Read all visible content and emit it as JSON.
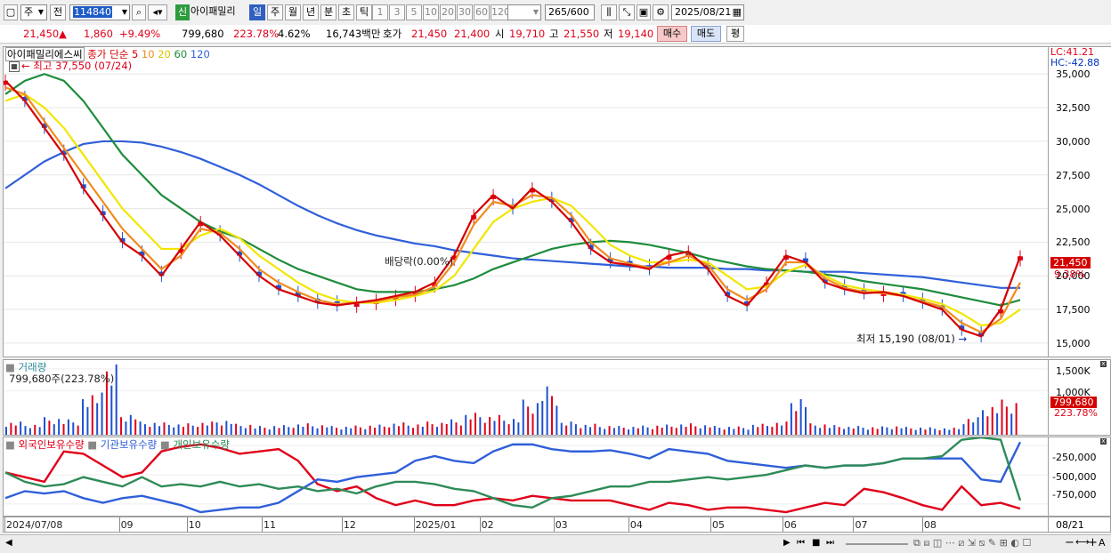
{
  "toolbar": {
    "market_select": "주",
    "prev_label": "전",
    "code_value": "114840",
    "stock_name": "아이패밀리",
    "shin_label": "신",
    "period_tabs": [
      "일",
      "주",
      "월",
      "년",
      "분",
      "초",
      "틱"
    ],
    "active_period": "일",
    "intervals": [
      "1",
      "3",
      "5",
      "10",
      "20",
      "30",
      "60",
      "120"
    ],
    "count_value": "265",
    "count_total": "/600",
    "date_value": "2025/08/21"
  },
  "quote": {
    "price": "21,450",
    "change": "1,860",
    "change_pct": "+9.49%",
    "volume": "799,680",
    "volume_ratio": "223.78%",
    "turnover_pct": "4.62%",
    "amount": "16,743백만",
    "hoga_label": "호가",
    "ask": "21,450",
    "bid": "21,400",
    "open_label": "시",
    "open": "19,710",
    "high_label": "고",
    "high": "21,550",
    "low_label": "저",
    "low": "19,140",
    "buy_button": "매수",
    "sell_button": "매도",
    "eval_button": "평"
  },
  "price_chart": {
    "title": "아이패밀리에스씨",
    "ma_label": "종가 단순",
    "ma_periods": [
      "5",
      "10",
      "20",
      "60",
      "120"
    ],
    "ma_colors": [
      "#d40000",
      "#f08c1e",
      "#f2e600",
      "#1e8c3c",
      "#2f5fd9"
    ],
    "high_note": "최고 37,550 (07/24)",
    "low_note": "최저 15,190 (08/01)",
    "dividend_note": "배당락(0.00%)",
    "lc_label": "LC:41.21",
    "hc_label": "HC:-42.88",
    "y_ticks": [
      "35,000",
      "32,500",
      "30,000",
      "27,500",
      "25,000",
      "22,500",
      "20,000",
      "17,500",
      "15,000"
    ],
    "last_price_tag": "21,450",
    "last_pct_tag": "9.38%"
  },
  "volume_chart": {
    "title": "거래량",
    "value_note": "799,680주(223.78%)",
    "y_ticks": [
      "1,500K",
      "1,000K"
    ],
    "last_tag": "799,680",
    "last_pct_tag": "223.78%"
  },
  "holdings_chart": {
    "legend": [
      "외국인보유수량",
      "기관보유수량",
      "개인보유수량"
    ],
    "colors": [
      "#e0001a",
      "#2f5fd9",
      "#2e8b57"
    ],
    "y_ticks": [
      "-250,000",
      "-500,000",
      "-750,000"
    ]
  },
  "x_axis": {
    "labels": [
      "2024/07/08",
      "09",
      "10",
      "11",
      "12",
      "2025/01",
      "02",
      "03",
      "04",
      "05",
      "06",
      "07",
      "08"
    ],
    "end_label": "08/21"
  },
  "chart_data": {
    "type": "line",
    "series": [
      {
        "name": "5",
        "values": [
          34500,
          33000,
          31000,
          29000,
          26500,
          24500,
          22500,
          21500,
          20000,
          22000,
          24000,
          23000,
          21500,
          20000,
          19000,
          18500,
          18000,
          17800,
          18000,
          18200,
          18500,
          18800,
          19500,
          21500,
          24500,
          26000,
          25000,
          26500,
          25500,
          24000,
          22000,
          21000,
          20800,
          20500,
          21500,
          21800,
          20500,
          18500,
          17800,
          19500,
          21500,
          21000,
          19500,
          19000,
          18700,
          18800,
          18500,
          18000,
          17500,
          16000,
          15500,
          17500,
          21450
        ]
      },
      {
        "name": "10",
        "values": [
          34000,
          33500,
          31500,
          29500,
          27500,
          25500,
          23500,
          22000,
          20500,
          21500,
          23500,
          23200,
          22000,
          20500,
          19500,
          18800,
          18200,
          17900,
          18000,
          18100,
          18400,
          18600,
          19200,
          21000,
          23800,
          25500,
          25200,
          26000,
          25800,
          24500,
          22500,
          21300,
          20900,
          20600,
          21000,
          21500,
          20800,
          19000,
          18200,
          19000,
          21000,
          21000,
          19800,
          19100,
          18800,
          18700,
          18500,
          18100,
          17700,
          16500,
          15800,
          16800,
          19500
        ]
      },
      {
        "name": "20",
        "values": [
          33000,
          33500,
          32500,
          31000,
          29000,
          27000,
          25000,
          23500,
          22000,
          22000,
          23000,
          23500,
          22800,
          21500,
          20500,
          19500,
          18700,
          18200,
          18000,
          18000,
          18200,
          18500,
          18900,
          20000,
          22000,
          24000,
          25000,
          25500,
          25800,
          25200,
          23800,
          22300,
          21500,
          21000,
          21000,
          21200,
          21000,
          20000,
          19000,
          19200,
          20300,
          20800,
          20000,
          19300,
          19000,
          18800,
          18600,
          18300,
          17900,
          17200,
          16300,
          16500,
          17500
        ]
      },
      {
        "name": "60",
        "values": [
          33500,
          34500,
          35000,
          34500,
          33000,
          31000,
          29000,
          27500,
          26000,
          25000,
          24000,
          23300,
          22800,
          22000,
          21200,
          20500,
          20000,
          19500,
          19000,
          18800,
          18800,
          18800,
          19000,
          19300,
          19800,
          20500,
          21000,
          21500,
          22000,
          22300,
          22500,
          22600,
          22500,
          22300,
          22000,
          21700,
          21300,
          21000,
          20700,
          20500,
          20400,
          20300,
          20100,
          19900,
          19600,
          19400,
          19200,
          19000,
          18700,
          18400,
          18100,
          17800,
          18200
        ]
      },
      {
        "name": "120",
        "values": [
          26500,
          27500,
          28500,
          29200,
          29800,
          30000,
          30000,
          29900,
          29600,
          29200,
          28700,
          28100,
          27500,
          26800,
          26000,
          25200,
          24500,
          23900,
          23400,
          23000,
          22700,
          22400,
          22200,
          21900,
          21700,
          21500,
          21300,
          21200,
          21100,
          21000,
          20900,
          20800,
          20700,
          20700,
          20600,
          20600,
          20600,
          20500,
          20500,
          20400,
          20400,
          20300,
          20300,
          20300,
          20200,
          20100,
          20000,
          19900,
          19700,
          19500,
          19300,
          19100,
          19100
        ]
      }
    ],
    "ylim": [
      14000,
      37000
    ],
    "volume": [
      300,
      250,
      400,
      350,
      900,
      1600,
      500,
      300,
      280,
      260,
      300,
      350,
      250,
      200,
      220,
      260,
      240,
      200,
      210,
      230,
      280,
      260,
      300,
      350,
      500,
      450,
      400,
      800,
      1100,
      300,
      250,
      220,
      200,
      210,
      230,
      260,
      240,
      200,
      190,
      250,
      300,
      900,
      260,
      220,
      200,
      190,
      210,
      180,
      170,
      160,
      400,
      700,
      800
    ],
    "foreign": [
      -480,
      -520,
      -560,
      -300,
      -320,
      -420,
      -520,
      -480,
      -300,
      -260,
      -240,
      -270,
      -320,
      -300,
      -280,
      -380,
      -580,
      -640,
      -600,
      -700,
      -760,
      -720,
      -760,
      -760,
      -720,
      -700,
      -720,
      -680,
      -700,
      -720,
      -720,
      -720,
      -760,
      -800,
      -740,
      -760,
      -800,
      -780,
      -780,
      -800,
      -820,
      -780,
      -740,
      -760,
      -620,
      -650,
      -700,
      -760,
      -800,
      -600,
      -760,
      -740,
      -790
    ],
    "institution": [
      -700,
      -640,
      -660,
      -640,
      -700,
      -740,
      -700,
      -680,
      -720,
      -760,
      -820,
      -800,
      -780,
      -780,
      -740,
      -640,
      -540,
      -560,
      -520,
      -500,
      -480,
      -380,
      -340,
      -380,
      -400,
      -300,
      -240,
      -240,
      -280,
      -300,
      -300,
      -290,
      -320,
      -360,
      -280,
      -300,
      -320,
      -380,
      -400,
      -420,
      -440,
      -420,
      -440,
      -420,
      -420,
      -400,
      -360,
      -360,
      -360,
      -360,
      -540,
      -560,
      -220
    ],
    "individual": [
      -480,
      -560,
      -600,
      -580,
      -520,
      -560,
      -600,
      -520,
      -600,
      -580,
      -600,
      -560,
      -600,
      -580,
      -620,
      -600,
      -640,
      -620,
      -660,
      -600,
      -560,
      -560,
      -580,
      -620,
      -640,
      -700,
      -760,
      -780,
      -700,
      -680,
      -640,
      -600,
      -600,
      -560,
      -560,
      -540,
      -520,
      -540,
      -520,
      -500,
      -460,
      -420,
      -440,
      -420,
      -420,
      -400,
      -360,
      -360,
      -340,
      -200,
      -180,
      -200,
      -720
    ],
    "holdings_ylim": [
      -850,
      -180
    ]
  }
}
